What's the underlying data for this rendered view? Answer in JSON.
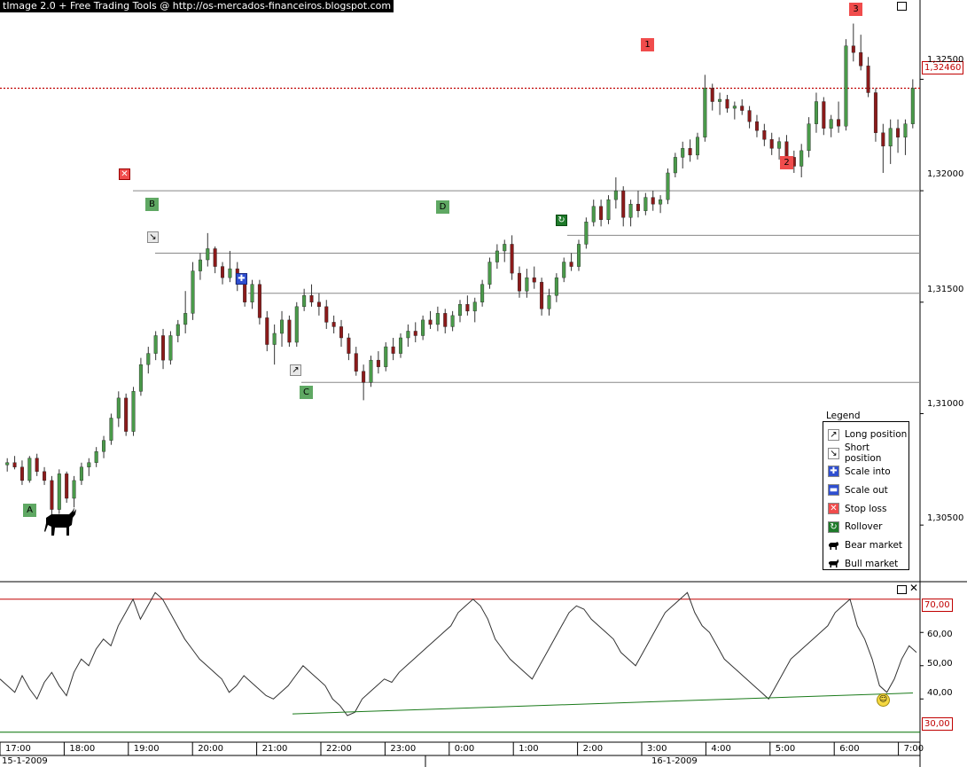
{
  "title": "tImage 2.0 + Free Trading Tools @ http://os-mercados-financeiros.blogspot.com",
  "chart_data": {
    "type": "candlestick",
    "price_axis": {
      "ticks": [
        "1,32500",
        "1,32000",
        "1,31500",
        "1,31000",
        "1,30500"
      ],
      "ylim": [
        1.3025,
        1.328
      ]
    },
    "time_axis": {
      "ticks": [
        "17:00",
        "18:00",
        "19:00",
        "20:00",
        "21:00",
        "22:00",
        "23:00",
        "0:00",
        "1:00",
        "2:00",
        "3:00",
        "4:00",
        "5:00",
        "6:00",
        "7:00"
      ]
    },
    "dates": [
      "15-1-2009",
      "16-1-2009"
    ],
    "current_price": {
      "value": 1.3246,
      "label": "1,32460",
      "color": "#c00000"
    },
    "levels": [
      {
        "value": 1.32
      },
      {
        "value": 1.318
      },
      {
        "value": 1.3172
      },
      {
        "value": 1.3154
      },
      {
        "value": 1.3114
      }
    ],
    "candles": [
      [
        1.3077,
        1.308,
        1.3074,
        1.3078
      ],
      [
        1.3078,
        1.3081,
        1.3075,
        1.3076
      ],
      [
        1.3076,
        1.3079,
        1.3068,
        1.307
      ],
      [
        1.307,
        1.3081,
        1.3069,
        1.308
      ],
      [
        1.308,
        1.3082,
        1.3072,
        1.3074
      ],
      [
        1.3074,
        1.3076,
        1.3068,
        1.307
      ],
      [
        1.307,
        1.3072,
        1.3054,
        1.3057
      ],
      [
        1.3057,
        1.3075,
        1.3055,
        1.3073
      ],
      [
        1.3073,
        1.3074,
        1.306,
        1.3062
      ],
      [
        1.3062,
        1.3072,
        1.3058,
        1.307
      ],
      [
        1.307,
        1.3078,
        1.3068,
        1.3076
      ],
      [
        1.3076,
        1.308,
        1.3072,
        1.3078
      ],
      [
        1.3078,
        1.3085,
        1.3076,
        1.3083
      ],
      [
        1.3083,
        1.309,
        1.308,
        1.3088
      ],
      [
        1.3088,
        1.31,
        1.3086,
        1.3098
      ],
      [
        1.3098,
        1.311,
        1.3094,
        1.3107
      ],
      [
        1.3107,
        1.3109,
        1.309,
        1.3092
      ],
      [
        1.3092,
        1.3112,
        1.309,
        1.311
      ],
      [
        1.311,
        1.3125,
        1.3108,
        1.3122
      ],
      [
        1.3122,
        1.313,
        1.3118,
        1.3127
      ],
      [
        1.3127,
        1.3137,
        1.3124,
        1.3135
      ],
      [
        1.3135,
        1.3138,
        1.312,
        1.3124
      ],
      [
        1.3124,
        1.3137,
        1.3122,
        1.3135
      ],
      [
        1.3135,
        1.3142,
        1.3132,
        1.314
      ],
      [
        1.314,
        1.3155,
        1.3136,
        1.3145
      ],
      [
        1.3145,
        1.3168,
        1.3142,
        1.3164
      ],
      [
        1.3164,
        1.3172,
        1.316,
        1.3169
      ],
      [
        1.3169,
        1.3181,
        1.3166,
        1.3174
      ],
      [
        1.3174,
        1.3175,
        1.3163,
        1.3166
      ],
      [
        1.3166,
        1.3168,
        1.3158,
        1.3161
      ],
      [
        1.3161,
        1.3173,
        1.3159,
        1.3165
      ],
      [
        1.3165,
        1.3168,
        1.3155,
        1.3158
      ],
      [
        1.3158,
        1.3162,
        1.3148,
        1.315
      ],
      [
        1.315,
        1.316,
        1.3147,
        1.3158
      ],
      [
        1.3158,
        1.316,
        1.314,
        1.3143
      ],
      [
        1.3143,
        1.3146,
        1.3128,
        1.3131
      ],
      [
        1.3131,
        1.314,
        1.3122,
        1.3136
      ],
      [
        1.3136,
        1.3146,
        1.313,
        1.3142
      ],
      [
        1.3142,
        1.3144,
        1.313,
        1.3132
      ],
      [
        1.3132,
        1.315,
        1.313,
        1.3148
      ],
      [
        1.3148,
        1.3156,
        1.3146,
        1.3153
      ],
      [
        1.3153,
        1.3158,
        1.3148,
        1.315
      ],
      [
        1.315,
        1.3154,
        1.3144,
        1.3148
      ],
      [
        1.3148,
        1.3151,
        1.3138,
        1.3141
      ],
      [
        1.3141,
        1.3144,
        1.3136,
        1.3139
      ],
      [
        1.3139,
        1.3142,
        1.313,
        1.3134
      ],
      [
        1.3134,
        1.3136,
        1.3124,
        1.3127
      ],
      [
        1.3127,
        1.313,
        1.3117,
        1.3119
      ],
      [
        1.3119,
        1.3122,
        1.3106,
        1.3114
      ],
      [
        1.3114,
        1.3126,
        1.3112,
        1.3124
      ],
      [
        1.3124,
        1.3128,
        1.3118,
        1.3121
      ],
      [
        1.3121,
        1.3132,
        1.3119,
        1.313
      ],
      [
        1.313,
        1.3134,
        1.3124,
        1.3127
      ],
      [
        1.3127,
        1.3136,
        1.3125,
        1.3134
      ],
      [
        1.3134,
        1.314,
        1.313,
        1.3137
      ],
      [
        1.3137,
        1.3141,
        1.3132,
        1.3135
      ],
      [
        1.3135,
        1.3144,
        1.3133,
        1.3142
      ],
      [
        1.3142,
        1.3146,
        1.3138,
        1.314
      ],
      [
        1.314,
        1.3148,
        1.3137,
        1.3145
      ],
      [
        1.3145,
        1.3147,
        1.3136,
        1.3139
      ],
      [
        1.3139,
        1.3146,
        1.3137,
        1.3144
      ],
      [
        1.3144,
        1.3151,
        1.3141,
        1.3149
      ],
      [
        1.3149,
        1.3153,
        1.3144,
        1.3146
      ],
      [
        1.3146,
        1.3152,
        1.3141,
        1.315
      ],
      [
        1.315,
        1.316,
        1.3148,
        1.3158
      ],
      [
        1.3158,
        1.317,
        1.3156,
        1.3168
      ],
      [
        1.3168,
        1.3176,
        1.3165,
        1.3173
      ],
      [
        1.3173,
        1.3178,
        1.3168,
        1.3176
      ],
      [
        1.3176,
        1.318,
        1.316,
        1.3163
      ],
      [
        1.3163,
        1.3166,
        1.3152,
        1.3155
      ],
      [
        1.3155,
        1.3165,
        1.3152,
        1.3161
      ],
      [
        1.3161,
        1.3166,
        1.3156,
        1.3159
      ],
      [
        1.3159,
        1.3161,
        1.3144,
        1.3147
      ],
      [
        1.3147,
        1.3156,
        1.3144,
        1.3153
      ],
      [
        1.3153,
        1.3163,
        1.315,
        1.3161
      ],
      [
        1.3161,
        1.317,
        1.3159,
        1.3168
      ],
      [
        1.3168,
        1.3172,
        1.3164,
        1.3166
      ],
      [
        1.3166,
        1.3178,
        1.3164,
        1.3176
      ],
      [
        1.3176,
        1.3188,
        1.3174,
        1.3186
      ],
      [
        1.3186,
        1.3196,
        1.3184,
        1.3193
      ],
      [
        1.3193,
        1.3196,
        1.3184,
        1.3187
      ],
      [
        1.3187,
        1.3198,
        1.3185,
        1.3196
      ],
      [
        1.3196,
        1.3206,
        1.3192,
        1.32
      ],
      [
        1.32,
        1.3202,
        1.3184,
        1.3188
      ],
      [
        1.3188,
        1.3196,
        1.3184,
        1.3194
      ],
      [
        1.3194,
        1.32,
        1.3188,
        1.3191
      ],
      [
        1.3191,
        1.3199,
        1.3189,
        1.3197
      ],
      [
        1.3197,
        1.32,
        1.3191,
        1.3194
      ],
      [
        1.3194,
        1.3198,
        1.319,
        1.3196
      ],
      [
        1.3196,
        1.321,
        1.3194,
        1.3208
      ],
      [
        1.3208,
        1.3217,
        1.3206,
        1.3215
      ],
      [
        1.3215,
        1.3222,
        1.321,
        1.3219
      ],
      [
        1.3219,
        1.3223,
        1.3213,
        1.3216
      ],
      [
        1.3216,
        1.3226,
        1.3214,
        1.3224
      ],
      [
        1.3224,
        1.3252,
        1.3222,
        1.3246
      ],
      [
        1.3246,
        1.3248,
        1.3236,
        1.324
      ],
      [
        1.324,
        1.3244,
        1.3234,
        1.3241
      ],
      [
        1.3241,
        1.3243,
        1.3235,
        1.3237
      ],
      [
        1.3237,
        1.324,
        1.3232,
        1.3238
      ],
      [
        1.3238,
        1.3241,
        1.3234,
        1.3236
      ],
      [
        1.3236,
        1.3238,
        1.3228,
        1.3231
      ],
      [
        1.3231,
        1.3234,
        1.3224,
        1.3227
      ],
      [
        1.3227,
        1.323,
        1.322,
        1.3223
      ],
      [
        1.3223,
        1.3226,
        1.3216,
        1.3219
      ],
      [
        1.3219,
        1.3224,
        1.3214,
        1.3222
      ],
      [
        1.3222,
        1.3225,
        1.3212,
        1.3215
      ],
      [
        1.3215,
        1.3218,
        1.3208,
        1.3211
      ],
      [
        1.3211,
        1.3221,
        1.3206,
        1.3218
      ],
      [
        1.3218,
        1.3233,
        1.3215,
        1.323
      ],
      [
        1.323,
        1.3244,
        1.3226,
        1.324
      ],
      [
        1.324,
        1.3242,
        1.3225,
        1.3228
      ],
      [
        1.3228,
        1.3234,
        1.3224,
        1.3232
      ],
      [
        1.3232,
        1.324,
        1.3226,
        1.3229
      ],
      [
        1.3229,
        1.3268,
        1.3227,
        1.3265
      ],
      [
        1.3265,
        1.3275,
        1.3258,
        1.3262
      ],
      [
        1.3262,
        1.327,
        1.3254,
        1.3256
      ],
      [
        1.3256,
        1.326,
        1.3242,
        1.3244
      ],
      [
        1.3244,
        1.3246,
        1.3222,
        1.3226
      ],
      [
        1.3226,
        1.323,
        1.3208,
        1.322
      ],
      [
        1.322,
        1.3232,
        1.3212,
        1.3228
      ],
      [
        1.3228,
        1.3232,
        1.3217,
        1.3224
      ],
      [
        1.3224,
        1.3232,
        1.3216,
        1.323
      ],
      [
        1.323,
        1.325,
        1.3228,
        1.3246
      ]
    ],
    "rsi": {
      "levels": [
        {
          "value": 70,
          "label": "70,00",
          "color": "#c00000"
        },
        {
          "value": 30,
          "label": "30,00",
          "color": "#007000"
        }
      ],
      "ticks": [
        "60,00",
        "50,00",
        "40,00"
      ],
      "ylim": [
        27,
        75
      ],
      "values": [
        46,
        44,
        42,
        47,
        43,
        40,
        45,
        48,
        44,
        41,
        48,
        52,
        50,
        55,
        58,
        56,
        62,
        66,
        70,
        64,
        68,
        72,
        70,
        66,
        62,
        58,
        55,
        52,
        50,
        48,
        46,
        42,
        44,
        47,
        45,
        43,
        41,
        40,
        42,
        44,
        47,
        50,
        48,
        46,
        44,
        40,
        38,
        35,
        36,
        40,
        42,
        44,
        46,
        45,
        48,
        50,
        52,
        54,
        56,
        58,
        60,
        62,
        66,
        68,
        70,
        68,
        64,
        58,
        55,
        52,
        50,
        48,
        46,
        50,
        54,
        58,
        62,
        66,
        68,
        67,
        64,
        62,
        60,
        58,
        54,
        52,
        50,
        54,
        58,
        62,
        66,
        68,
        70,
        72,
        66,
        62,
        60,
        56,
        52,
        50,
        48,
        46,
        44,
        42,
        40,
        44,
        48,
        52,
        54,
        56,
        58,
        60,
        62,
        66,
        68,
        70,
        62,
        58,
        52,
        44,
        42,
        46,
        52,
        56,
        54
      ]
    },
    "rsi_trendline": {
      "from": 35.5,
      "to": 41.8
    }
  },
  "markers": [
    {
      "label": "A",
      "color": "green"
    },
    {
      "label": "B",
      "color": "green"
    },
    {
      "label": "C",
      "color": "green"
    },
    {
      "label": "D",
      "color": "green"
    },
    {
      "label": "1",
      "color": "red"
    },
    {
      "label": "2",
      "color": "red"
    },
    {
      "label": "3",
      "color": "red"
    }
  ],
  "legend": {
    "title": "Legend",
    "items": [
      {
        "label": "Long position",
        "icon": "long-arrow-icon"
      },
      {
        "label": "Short position",
        "icon": "short-arrow-icon"
      },
      {
        "label": "Scale into",
        "icon": "scale-into-icon"
      },
      {
        "label": "Scale out",
        "icon": "scale-out-icon"
      },
      {
        "label": "Stop loss",
        "icon": "stop-loss-icon"
      },
      {
        "label": "Rollover",
        "icon": "rollover-icon"
      },
      {
        "label": "Bear market",
        "icon": "bear-icon"
      },
      {
        "label": "Bull market",
        "icon": "bull-icon"
      }
    ]
  },
  "colors": {
    "bull_candle": "#4a9a4a",
    "bear_candle": "#8b1a1a",
    "grid_line": "#888888"
  }
}
